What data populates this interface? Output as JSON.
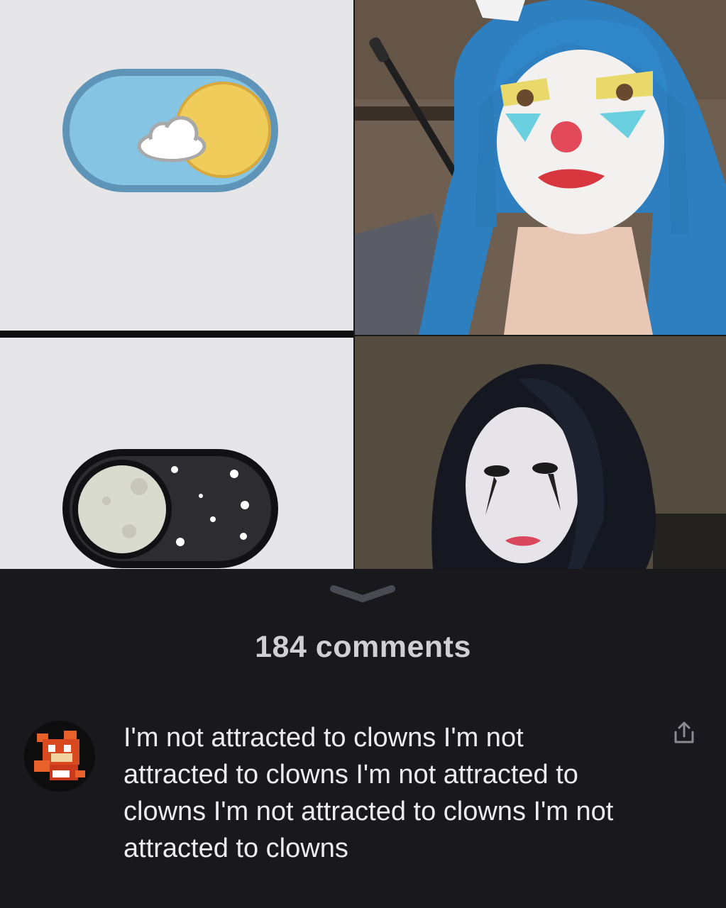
{
  "panels": [
    {
      "name": "light-mode-toggle",
      "description_icon": "sun-cloud-toggle-icon",
      "state": "on-light"
    },
    {
      "name": "clown-photo",
      "icon": "photo"
    },
    {
      "name": "dark-mode-toggle",
      "description_icon": "moon-stars-toggle-icon",
      "state": "on-dark"
    },
    {
      "name": "mime-photo",
      "icon": "photo"
    }
  ],
  "comments": {
    "count_label": "184 comments",
    "expand_icon": "chevron-down-icon",
    "items": [
      {
        "avatar_icon": "pixel-art-avatar-icon",
        "text": "I'm not attracted to clowns I'm not attracted to clowns I'm not attracted to clowns I'm not attracted to clowns I'm not attracted to clowns",
        "share_icon": "share-icon"
      }
    ]
  },
  "colors": {
    "background": "#19181d",
    "panel_light": "#e6e6e8",
    "toggle_sky": "#86c4e3",
    "toggle_sky_border": "#5e94b8",
    "sun": "#f0cc5a",
    "toggle_night": "#2d2d31",
    "moon": "#dadbcf",
    "text": "#ececf0",
    "count_text": "#cfcfd4"
  }
}
